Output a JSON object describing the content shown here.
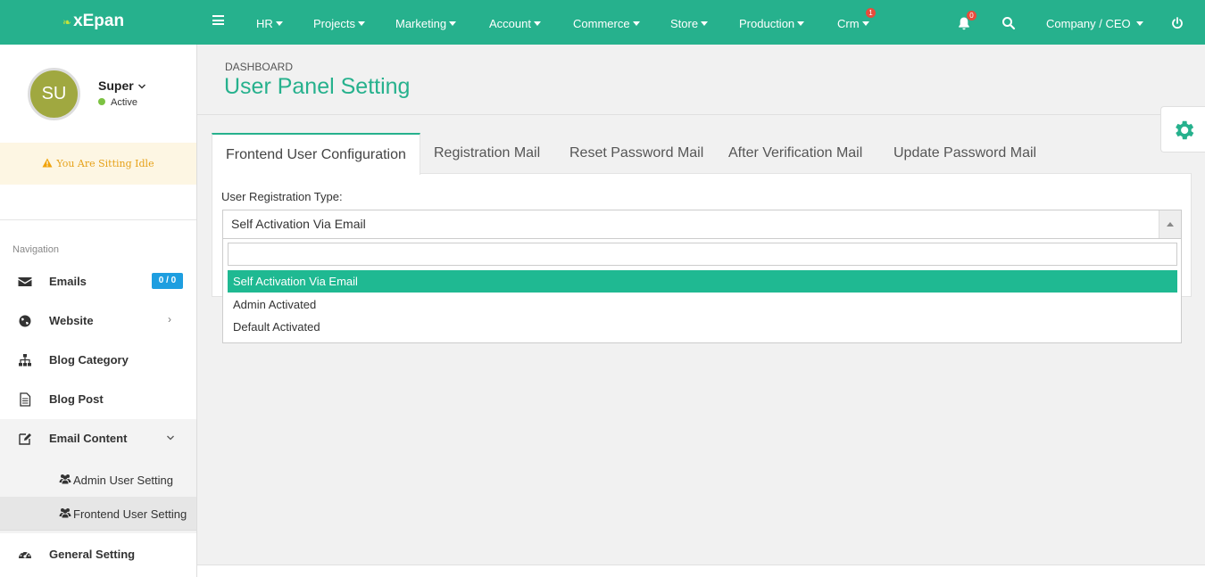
{
  "app": {
    "logo_text": "xEpan"
  },
  "topnav": {
    "items": [
      {
        "label": "HR"
      },
      {
        "label": "Projects"
      },
      {
        "label": "Marketing"
      },
      {
        "label": "Account"
      },
      {
        "label": "Commerce"
      },
      {
        "label": "Store"
      },
      {
        "label": "Production"
      },
      {
        "label": "Crm",
        "badge": "1"
      }
    ],
    "notifications_badge": "0",
    "user_menu": "Company / CEO",
    "icons": [
      "menu-icon",
      "bell-icon",
      "search-icon",
      "power-icon"
    ],
    "bar_color": "#26b18d"
  },
  "sidebar": {
    "avatar_initials": "SU",
    "user_name": "Super",
    "user_status": "Active",
    "idle_message": "You Are Sitting Idle",
    "nav_heading": "Navigation",
    "items": [
      {
        "label": "Emails",
        "badge": "0 / 0",
        "icon": "envelope-icon"
      },
      {
        "label": "Website",
        "icon": "globe-icon"
      },
      {
        "label": "Blog Category",
        "icon": "sitemap-icon"
      },
      {
        "label": "Blog Post",
        "icon": "file-icon"
      },
      {
        "label": "Email Content",
        "icon": "edit-icon"
      },
      {
        "label": "General Setting",
        "icon": "dashboard-icon"
      }
    ],
    "sub_items": [
      {
        "label": "Admin User Setting",
        "icon": "users-icon"
      },
      {
        "label": "Frontend User Setting",
        "icon": "users-icon"
      }
    ]
  },
  "main": {
    "breadcrumb": "DASHBOARD",
    "title": "User Panel Setting",
    "tabs": [
      {
        "label": "Frontend User Configuration"
      },
      {
        "label": "Registration Mail"
      },
      {
        "label": "Reset Password Mail"
      },
      {
        "label": "After Verification Mail"
      },
      {
        "label": "Update Password Mail"
      }
    ],
    "field_label": "User Registration Type:",
    "select_value": "Self Activation Via Email",
    "dropdown_search_value": "",
    "options": [
      {
        "label": "Self Activation Via Email",
        "selected": true
      },
      {
        "label": "Admin Activated"
      },
      {
        "label": "Default Activated"
      }
    ],
    "accent_color": "#26b18d"
  }
}
